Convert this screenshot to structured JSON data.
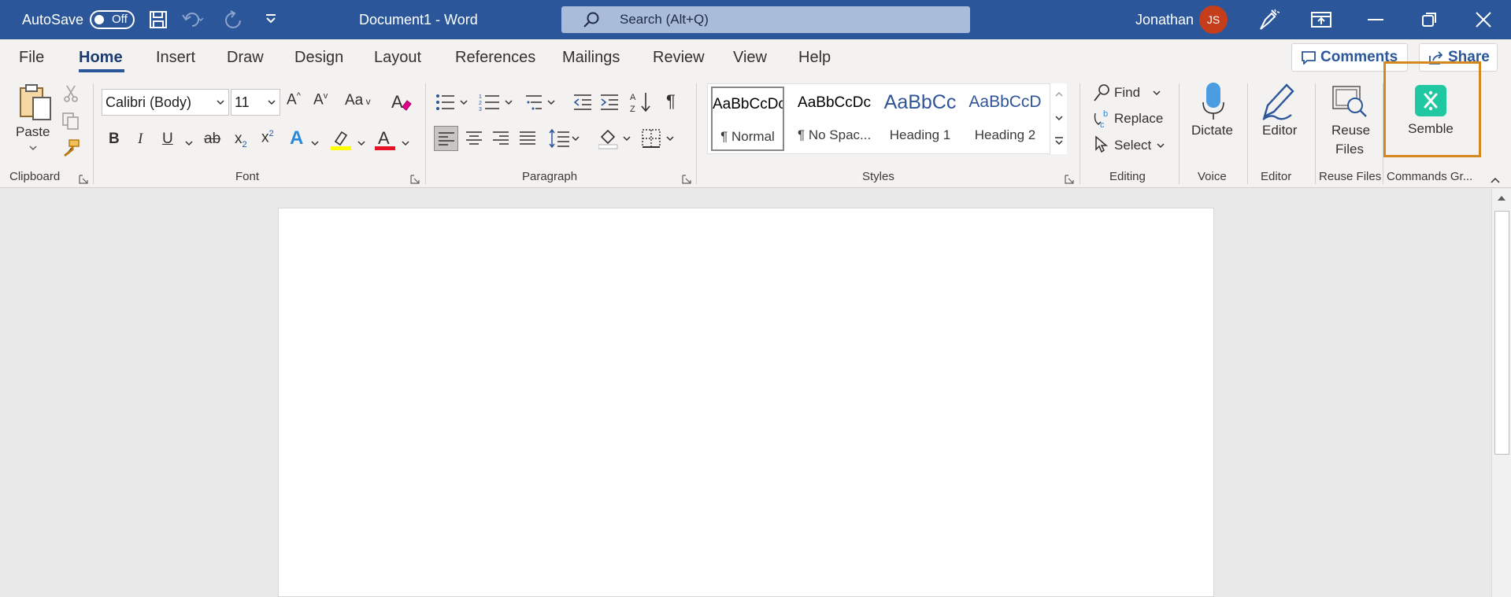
{
  "titlebar": {
    "autosave_label": "AutoSave",
    "autosave_state": "Off",
    "document_title": "Document1  -  Word",
    "search_placeholder": "Search (Alt+Q)",
    "user_name": "Jonathan",
    "user_initials": "JS"
  },
  "tabs": [
    "File",
    "Home",
    "Insert",
    "Draw",
    "Design",
    "Layout",
    "References",
    "Mailings",
    "Review",
    "View",
    "Help"
  ],
  "active_tab": "Home",
  "header_actions": {
    "comments": "Comments",
    "share": "Share"
  },
  "ribbon": {
    "clipboard": {
      "paste": "Paste",
      "group": "Clipboard"
    },
    "font": {
      "font_name": "Calibri (Body)",
      "font_size": "11",
      "change_case": "Aa",
      "group": "Font",
      "highlight_color": "#ffff00",
      "font_color": "#e81123"
    },
    "paragraph": {
      "group": "Paragraph"
    },
    "styles": {
      "group": "Styles",
      "items": [
        {
          "preview": "AaBbCcDc",
          "name": "¶ Normal"
        },
        {
          "preview": "AaBbCcDc",
          "name": "¶ No Spac..."
        },
        {
          "preview": "AaBbCc",
          "name": "Heading 1"
        },
        {
          "preview": "AaBbCcD",
          "name": "Heading 2"
        }
      ]
    },
    "editing": {
      "find": "Find",
      "replace": "Replace",
      "select": "Select",
      "group": "Editing"
    },
    "voice": {
      "dictate": "Dictate",
      "group": "Voice"
    },
    "editor": {
      "editor": "Editor",
      "group": "Editor"
    },
    "reuse_files": {
      "line1": "Reuse",
      "line2": "Files",
      "group": "Reuse Files"
    },
    "commands": {
      "semble": "Semble",
      "group": "Commands Gr..."
    }
  },
  "colors": {
    "brand": "#2b579a",
    "semble": "#1fc8a0",
    "highlight_box": "#d4891f"
  }
}
